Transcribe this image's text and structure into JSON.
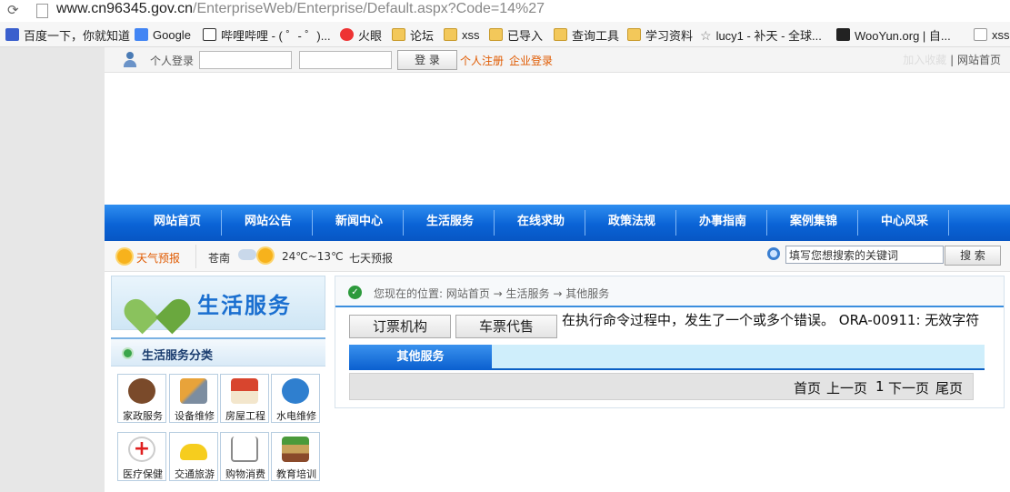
{
  "browser": {
    "url_host": "www.cn96345.gov.cn",
    "url_path": "/EnterpriseWeb/Enterprise/Default.aspx?Code=14%27",
    "bookmarks": [
      {
        "label": "百度一下，你就知道",
        "icon": "paw-icon"
      },
      {
        "label": "Google",
        "icon": "google-icon"
      },
      {
        "label": "哔哩哔哩 - ( ゜- ゜)...",
        "icon": "tv-icon"
      },
      {
        "label": "火眼",
        "icon": "eye-icon"
      },
      {
        "label": "论坛",
        "icon": "folder-icon"
      },
      {
        "label": "xss",
        "icon": "folder-icon"
      },
      {
        "label": "已导入",
        "icon": "folder-icon"
      },
      {
        "label": "查询工具",
        "icon": "folder-icon"
      },
      {
        "label": "学习资料",
        "icon": "folder-icon"
      },
      {
        "label": "lucy1 - 补天 - 全球...",
        "icon": "star-icon"
      },
      {
        "label": "WooYun.org | 自...",
        "icon": "wooyun-icon"
      },
      {
        "label": "xss",
        "icon": "page-icon"
      }
    ]
  },
  "login": {
    "label": "个人登录",
    "username_value": "",
    "password_value": "",
    "submit_label": "登 录",
    "register_link": "个人注册",
    "enterprise_link": "企业登录",
    "favorite_link": "加入收藏",
    "home_link": "网站首页"
  },
  "nav": [
    "网站首页",
    "网站公告",
    "新闻中心",
    "生活服务",
    "在线求助",
    "政策法规",
    "办事指南",
    "案例集锦",
    "中心风采"
  ],
  "weather": {
    "label": "天气预报",
    "city": "苍南",
    "temp": "24℃~13℃",
    "forecast_link": "七天预报"
  },
  "search": {
    "placeholder": "填写您想搜索的关键词",
    "button_label": "搜 索"
  },
  "sidebar": {
    "banner_title": "生活服务",
    "category_title": "生活服务分类",
    "services": [
      {
        "label": "家政服务",
        "icon": "housekeeper-icon"
      },
      {
        "label": "设备维修",
        "icon": "tools-icon"
      },
      {
        "label": "房屋工程",
        "icon": "house-icon"
      },
      {
        "label": "水电维修",
        "icon": "plumbing-icon"
      },
      {
        "label": "医疗保健",
        "icon": "medical-cross-icon"
      },
      {
        "label": "交通旅游",
        "icon": "car-icon"
      },
      {
        "label": "购物消费",
        "icon": "shopping-cart-icon"
      },
      {
        "label": "教育培训",
        "icon": "books-icon"
      }
    ]
  },
  "content": {
    "breadcrumb": "您现在的位置: 网站首页 → 生活服务 → 其他服务",
    "tab_ticket_agency": "订票机构",
    "tab_ticket_proxy": "车票代售",
    "error_message": "在执行命令过程中，发生了一个或多个错误。 ORA-00911: 无效字符",
    "section_title": "其他服务",
    "pager": {
      "first": "首页",
      "prev": "上一页",
      "page": "1",
      "next": "下一页",
      "last": "尾页"
    }
  },
  "colors": {
    "nav_blue": "#0a63d6",
    "link_orange": "#e05a00",
    "title_blue": "#1a6fd0"
  }
}
